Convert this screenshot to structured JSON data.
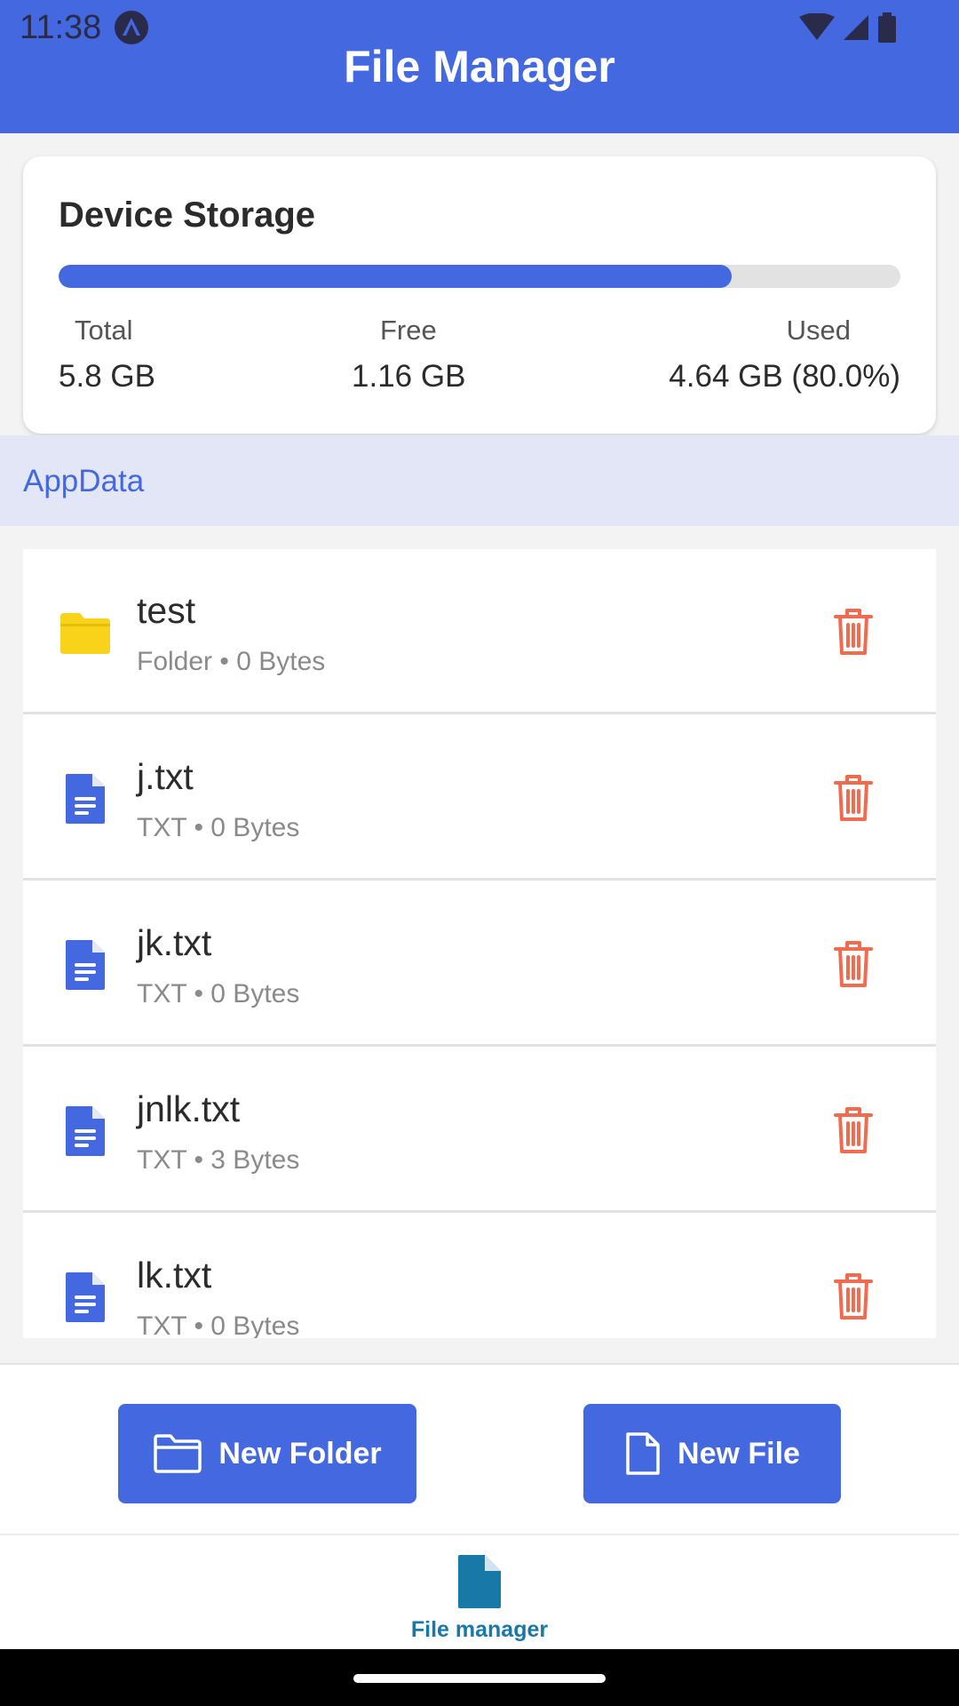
{
  "status_bar": {
    "time": "11:38"
  },
  "header": {
    "title": "File Manager"
  },
  "storage": {
    "title": "Device Storage",
    "used_fraction": 0.8,
    "total_label": "Total",
    "total_value": "5.8 GB",
    "free_label": "Free",
    "free_value": "1.16 GB",
    "used_label": "Used",
    "used_value": "4.64 GB (80.0%)"
  },
  "breadcrumb": {
    "label": "AppData"
  },
  "files": [
    {
      "name": "test",
      "meta": "Folder • 0 Bytes",
      "icon": "folder-icon",
      "kind": "folder"
    },
    {
      "name": "j.txt",
      "meta": "TXT • 0 Bytes",
      "icon": "document-icon",
      "kind": "file"
    },
    {
      "name": "jk.txt",
      "meta": "TXT • 0 Bytes",
      "icon": "document-icon",
      "kind": "file"
    },
    {
      "name": "jnlk.txt",
      "meta": "TXT • 3 Bytes",
      "icon": "document-icon",
      "kind": "file"
    },
    {
      "name": "lk.txt",
      "meta": "TXT • 0 Bytes",
      "icon": "document-icon",
      "kind": "file"
    }
  ],
  "actions": {
    "new_folder_label": "New Folder",
    "new_file_label": "New File"
  },
  "bottom_nav": {
    "tab_label": "File manager"
  },
  "colors": {
    "accent": "#4468e0",
    "delete": "#f26b4f",
    "folder": "#f9d21a",
    "nav_active": "#1878a8"
  }
}
